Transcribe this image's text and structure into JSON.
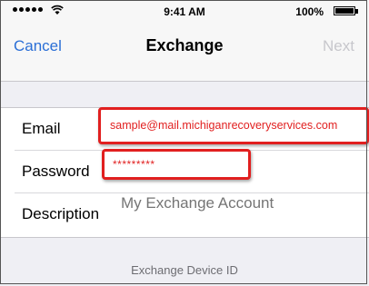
{
  "status_bar": {
    "time": "9:41 AM",
    "battery_percent": "100%",
    "signal_dots": 5
  },
  "nav": {
    "left_button": "Cancel",
    "title": "Exchange",
    "right_button": "Next"
  },
  "form": {
    "email": {
      "label": "Email",
      "value": "sample@mail.michiganrecoveryservices.com"
    },
    "password": {
      "label": "Password",
      "value": "*********"
    },
    "description": {
      "label": "Description",
      "placeholder": "My Exchange Account"
    }
  },
  "footer": {
    "label": "Exchange Device ID"
  },
  "colors": {
    "accent": "#2b6fd6",
    "highlight": "#e11f1f",
    "disabled": "#c7c7cc",
    "background": "#efeff4"
  }
}
